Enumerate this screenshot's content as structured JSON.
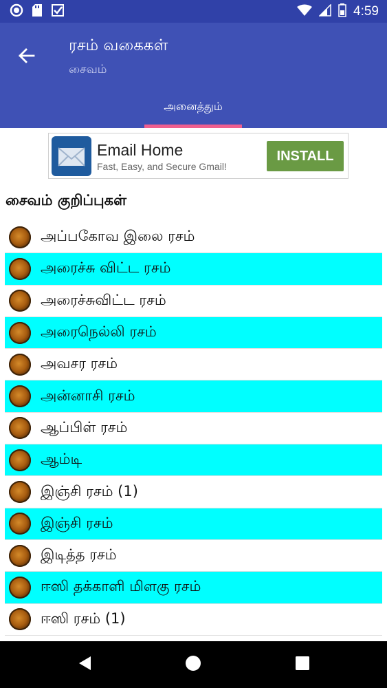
{
  "status_bar": {
    "time": "4:59",
    "left_icons": [
      "circle-icon",
      "sd-card-icon",
      "check-badge-icon"
    ],
    "right_icons": [
      "wifi-icon",
      "signal-icon",
      "battery-icon"
    ]
  },
  "app_bar": {
    "title": "ரசம் வகைகள்",
    "subtitle": "சைவம்",
    "back_icon": "arrow-left-icon",
    "tab_label": "அனைத்தும்",
    "color": "#3f51b5",
    "indicator_color": "#ef5f8f"
  },
  "ad": {
    "title": "Email Home",
    "description": "Fast, Easy, and Secure Gmail!",
    "install_label": "INSTALL",
    "button_color": "#6a9a44"
  },
  "section": {
    "title": "சைவம் குறிப்புகள்"
  },
  "list": {
    "highlight_color": "#00ffff",
    "items": [
      {
        "label": "அப்பகோவ இலை ரசம்"
      },
      {
        "label": "அரைச்சு விட்ட ரசம்"
      },
      {
        "label": "அரைச்சுவிட்ட ரசம்"
      },
      {
        "label": "அரைநெல்லி ரசம்"
      },
      {
        "label": "அவசர ரசம்"
      },
      {
        "label": "அன்னாசி ரசம்"
      },
      {
        "label": "ஆப்பிள் ரசம்"
      },
      {
        "label": "ஆம்டி"
      },
      {
        "label": "இஞ்சி ரசம் (1)"
      },
      {
        "label": "இஞ்சி ரசம்"
      },
      {
        "label": "இடித்த ரசம்"
      },
      {
        "label": "ஈஸி தக்காளி மிளகு ரசம்"
      },
      {
        "label": "ஈஸி ரசம் (1)"
      }
    ]
  },
  "nav_bar": {
    "icons": [
      "back-triangle-icon",
      "home-circle-icon",
      "recents-square-icon"
    ]
  }
}
